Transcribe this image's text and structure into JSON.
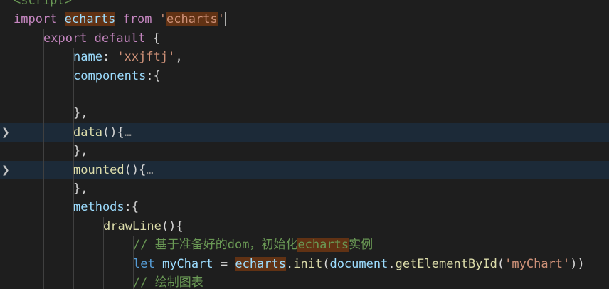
{
  "editor": {
    "theme_colors": {
      "background": "#1e1e1e",
      "highlight_line": "#1c2a38",
      "keyword": "#569cd6",
      "control_keyword": "#c586c0",
      "string": "#ce9178",
      "property": "#9cdcfe",
      "function": "#dcdcaa",
      "comment": "#6a9955",
      "find_match": "#613214"
    },
    "fold_icon": "chevron-right-icon",
    "lines": [
      {
        "tokens": [
          {
            "t": "<script>",
            "c": "cm"
          }
        ]
      },
      {
        "tokens": [
          {
            "t": "import",
            "c": "ctrl"
          },
          {
            "t": " ",
            "c": "punc"
          },
          {
            "t": "echarts",
            "c": "var match"
          },
          {
            "t": " ",
            "c": "punc"
          },
          {
            "t": "from",
            "c": "ctrl"
          },
          {
            "t": " ",
            "c": "punc"
          },
          {
            "t": "'",
            "c": "str"
          },
          {
            "t": "echarts",
            "c": "str match"
          },
          {
            "t": "'",
            "c": "str"
          }
        ],
        "cursor": true
      },
      {
        "tokens": [
          {
            "t": "export",
            "c": "ctrl"
          },
          {
            "t": " ",
            "c": "punc"
          },
          {
            "t": "default",
            "c": "ctrl"
          },
          {
            "t": " {",
            "c": "punc"
          }
        ]
      },
      {
        "tokens": [
          {
            "t": "name",
            "c": "prop"
          },
          {
            "t": ": ",
            "c": "punc"
          },
          {
            "t": "'xxjftj'",
            "c": "str"
          },
          {
            "t": ",",
            "c": "punc"
          }
        ]
      },
      {
        "tokens": [
          {
            "t": "components",
            "c": "prop"
          },
          {
            "t": ":{",
            "c": "punc"
          }
        ]
      },
      {
        "tokens": []
      },
      {
        "tokens": [
          {
            "t": "},",
            "c": "punc"
          }
        ]
      },
      {
        "tokens": [
          {
            "t": "data",
            "c": "fn"
          },
          {
            "t": "(){",
            "c": "punc"
          },
          {
            "t": "…",
            "c": "ell"
          }
        ],
        "fold": true,
        "highlight": true
      },
      {
        "tokens": [
          {
            "t": "},",
            "c": "punc"
          }
        ]
      },
      {
        "tokens": [
          {
            "t": "mounted",
            "c": "fn"
          },
          {
            "t": "(){",
            "c": "punc"
          },
          {
            "t": "…",
            "c": "ell"
          }
        ],
        "fold": true,
        "highlight": true
      },
      {
        "tokens": [
          {
            "t": "},",
            "c": "punc"
          }
        ]
      },
      {
        "tokens": [
          {
            "t": "methods",
            "c": "prop"
          },
          {
            "t": ":{",
            "c": "punc"
          }
        ]
      },
      {
        "tokens": [
          {
            "t": "drawLine",
            "c": "fn"
          },
          {
            "t": "(){",
            "c": "punc"
          }
        ]
      },
      {
        "tokens": [
          {
            "t": "// ",
            "c": "cm"
          },
          {
            "t": "基于准备好的",
            "c": "cm cjk"
          },
          {
            "t": "dom",
            "c": "cm"
          },
          {
            "t": "，初始化",
            "c": "cm cjk"
          },
          {
            "t": "echarts",
            "c": "cm match"
          },
          {
            "t": "实例",
            "c": "cm cjk"
          }
        ]
      },
      {
        "tokens": [
          {
            "t": "let",
            "c": "kw"
          },
          {
            "t": " ",
            "c": "punc"
          },
          {
            "t": "myChart",
            "c": "var"
          },
          {
            "t": " = ",
            "c": "punc"
          },
          {
            "t": "echarts",
            "c": "var match"
          },
          {
            "t": ".",
            "c": "punc"
          },
          {
            "t": "init",
            "c": "fn"
          },
          {
            "t": "(",
            "c": "punc"
          },
          {
            "t": "document",
            "c": "var"
          },
          {
            "t": ".",
            "c": "punc"
          },
          {
            "t": "getElementById",
            "c": "fn"
          },
          {
            "t": "(",
            "c": "punc"
          },
          {
            "t": "'myChart'",
            "c": "str"
          },
          {
            "t": "))",
            "c": "punc"
          }
        ]
      },
      {
        "tokens": [
          {
            "t": "// ",
            "c": "cm"
          },
          {
            "t": "绘制图表",
            "c": "cm cjk"
          }
        ]
      }
    ]
  }
}
